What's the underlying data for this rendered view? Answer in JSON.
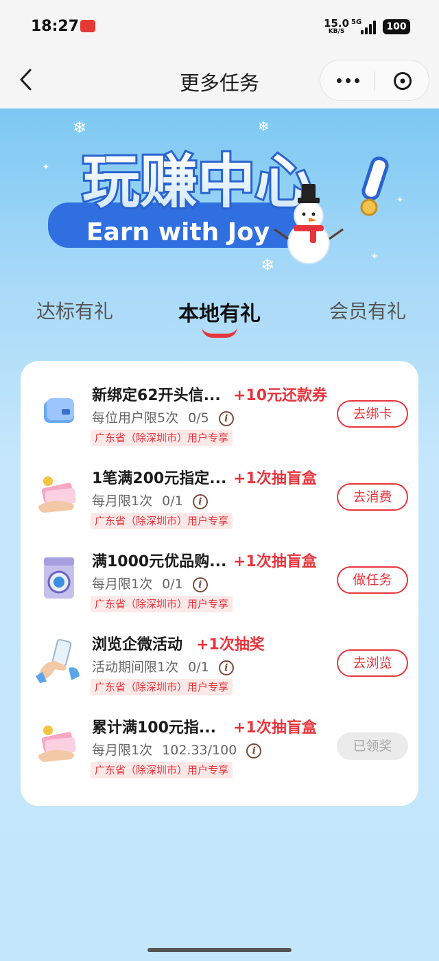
{
  "status_bar": {
    "time": "18:27",
    "net_speed_value": "15.0",
    "net_speed_unit": "KB/S",
    "network_type": "5G",
    "battery": "100"
  },
  "nav": {
    "title": "更多任务"
  },
  "hero": {
    "banner_title": "玩赚中心",
    "banner_subtitle": "Earn with Joy"
  },
  "tabs": [
    {
      "label": "达标有礼",
      "active": false
    },
    {
      "label": "本地有礼",
      "active": true
    },
    {
      "label": "会员有礼",
      "active": false
    }
  ],
  "tasks": [
    {
      "icon": "card-icon",
      "title": "新绑定62开头信...",
      "reward": "+10元还款券",
      "limit": "每位用户限5次",
      "progress": "0/5",
      "tag": "广东省（除深圳市）用户专享",
      "button": "去绑卡",
      "done": false
    },
    {
      "icon": "money-hand-icon",
      "title": "1笔满200元指定...",
      "reward": "+1次抽盲盒",
      "limit": "每月限1次",
      "progress": "0/1",
      "tag": "广东省（除深圳市）用户专享",
      "button": "去消费",
      "done": false
    },
    {
      "icon": "washing-machine-icon",
      "title": "满1000元优品购...",
      "reward": "+1次抽盲盒",
      "limit": "每月限1次",
      "progress": "0/1",
      "tag": "广东省（除深圳市）用户专享",
      "button": "做任务",
      "done": false
    },
    {
      "icon": "phone-hand-icon",
      "title": "浏览企微活动",
      "reward": "+1次抽奖",
      "limit": "活动期间限1次",
      "progress": "0/1",
      "tag": "广东省（除深圳市）用户专享",
      "button": "去浏览",
      "done": false
    },
    {
      "icon": "money-hand-icon",
      "title": "累计满100元指...",
      "reward": "+1次抽盲盒",
      "limit": "每月限1次",
      "progress": "102.33/100",
      "tag": "广东省（除深圳市）用户专享",
      "button": "已领奖",
      "done": true
    }
  ],
  "colors": {
    "accent": "#e8343c",
    "hero_blue": "#7dc8f3",
    "card_bg": "#ffffff"
  }
}
